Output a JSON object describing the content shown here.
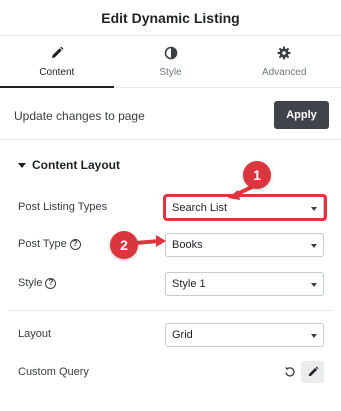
{
  "header": {
    "title": "Edit Dynamic Listing"
  },
  "tabs": [
    {
      "label": "Content",
      "icon": "pencil-icon",
      "active": true
    },
    {
      "label": "Style",
      "icon": "half-circle-icon",
      "active": false
    },
    {
      "label": "Advanced",
      "icon": "gear-icon",
      "active": false
    }
  ],
  "apply_bar": {
    "text": "Update changes to page",
    "button_label": "Apply"
  },
  "section": {
    "title": "Content Layout",
    "expanded": true
  },
  "controls": {
    "post_listing_types": {
      "label": "Post Listing Types",
      "value": "Search List"
    },
    "post_type": {
      "label": "Post Type",
      "value": "Books",
      "help_icon": "question-circle-icon"
    },
    "style": {
      "label": "Style",
      "value": "Style 1",
      "help_icon": "question-circle-icon"
    },
    "layout": {
      "label": "Layout",
      "value": "Grid"
    },
    "custom_query": {
      "label": "Custom Query",
      "icons": [
        "reset-icon",
        "pencil-icon"
      ]
    }
  },
  "annotations": [
    {
      "number": "1",
      "color": "#d9363e"
    },
    {
      "number": "2",
      "color": "#d9363e"
    }
  ],
  "colors": {
    "accent_dark": "#404349",
    "annotation_red": "#e0353c",
    "border": "#c6cbd0"
  }
}
